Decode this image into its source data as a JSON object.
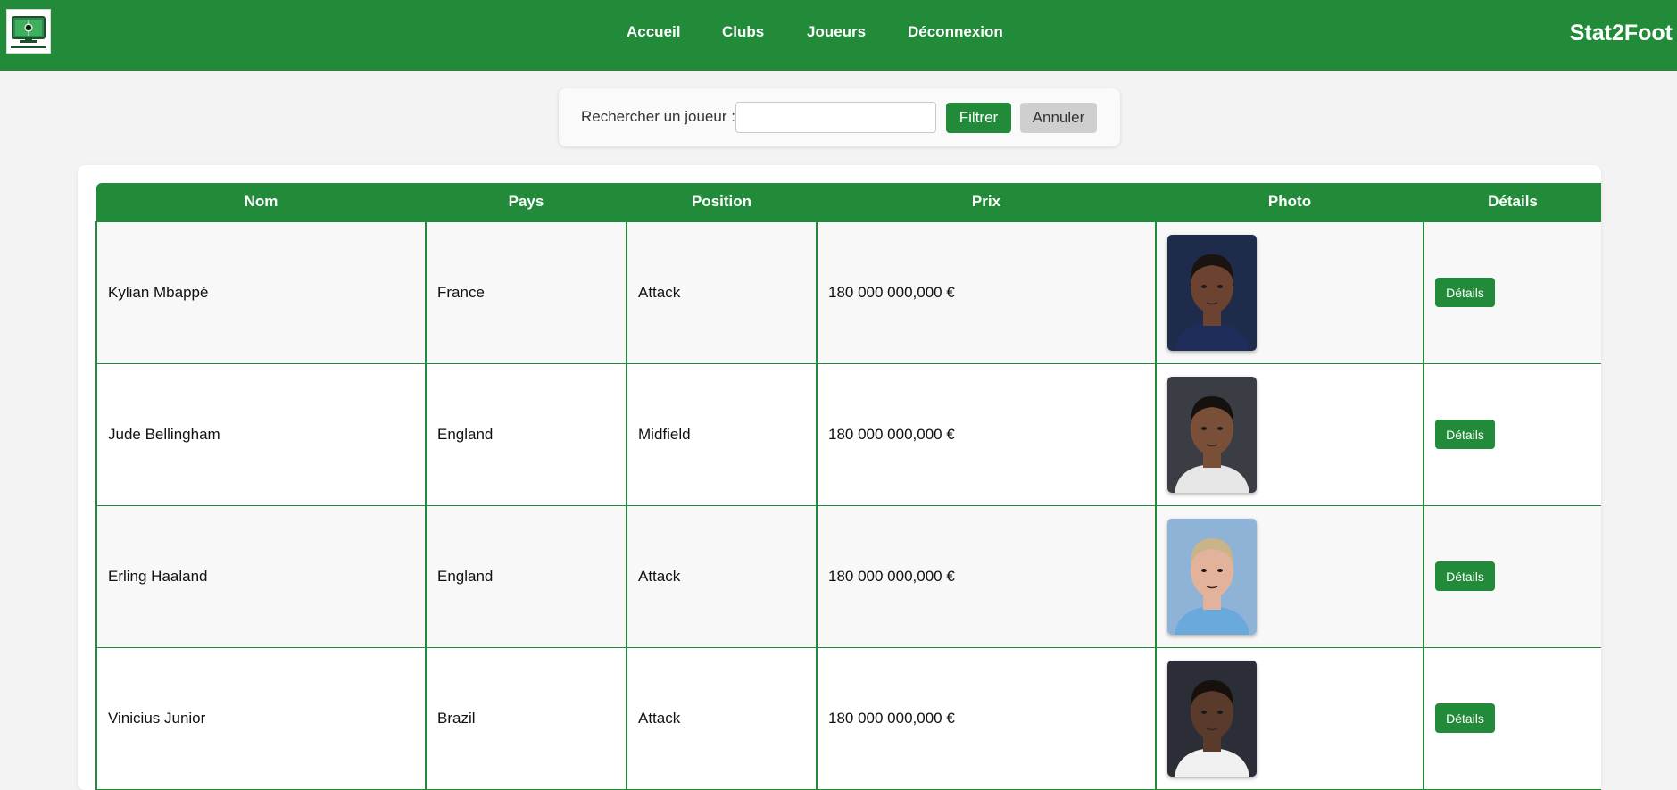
{
  "header": {
    "logo_icon": "football-screen-logo-icon",
    "nav": [
      {
        "label": "Accueil"
      },
      {
        "label": "Clubs"
      },
      {
        "label": "Joueurs"
      },
      {
        "label": "Déconnexion"
      }
    ],
    "brand": "Stat2Foot",
    "color": "#228b3a"
  },
  "search": {
    "label": "Rechercher un joueur :",
    "value": "",
    "placeholder": "",
    "filter_label": "Filtrer",
    "cancel_label": "Annuler"
  },
  "table": {
    "columns": [
      "Nom",
      "Pays",
      "Position",
      "Prix",
      "Photo",
      "Détails"
    ],
    "rows": [
      {
        "nom": "Kylian Mbappé",
        "pays": "France",
        "position": "Attack",
        "prix": "180 000 000,000 €",
        "photo": "player-photo",
        "details_label": "Détails",
        "photo_palette": {
          "bg": "#1e2b4a",
          "skin": "#6b4330",
          "hair": "#1a1410",
          "shirt": "#1f2d5a"
        }
      },
      {
        "nom": "Jude Bellingham",
        "pays": "England",
        "position": "Midfield",
        "prix": "180 000 000,000 €",
        "photo": "player-photo",
        "details_label": "Détails",
        "photo_palette": {
          "bg": "#3a3d44",
          "skin": "#7a4f38",
          "hair": "#15110e",
          "shirt": "#e6e6e6"
        }
      },
      {
        "nom": "Erling Haaland",
        "pays": "England",
        "position": "Attack",
        "prix": "180 000 000,000 €",
        "photo": "player-photo",
        "details_label": "Détails",
        "photo_palette": {
          "bg": "#8fb3d6",
          "skin": "#e2b39a",
          "hair": "#c9b48a",
          "shirt": "#6aa9dc"
        }
      },
      {
        "nom": "Vinicius Junior",
        "pays": "Brazil",
        "position": "Attack",
        "prix": "180 000 000,000 €",
        "photo": "player-photo",
        "details_label": "Détails",
        "photo_palette": {
          "bg": "#2b2e36",
          "skin": "#5a3a2a",
          "hair": "#16110d",
          "shirt": "#f0f0f0"
        }
      }
    ]
  }
}
